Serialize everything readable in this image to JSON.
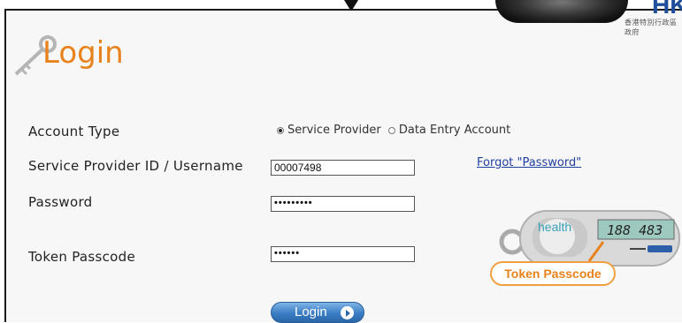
{
  "header": {
    "brand_text": "HKG",
    "brand_sub": "香港特別行政區政府"
  },
  "login": {
    "title": "Login",
    "account_type_label": "Account Type",
    "account_type_options": [
      "Service Provider",
      "Data Entry Account"
    ],
    "account_type_selected": "Service Provider",
    "username_label": "Service Provider ID / Username",
    "username_value": "00007498",
    "password_label": "Password",
    "password_value": "•••••••••",
    "token_label": "Token Passcode",
    "token_value": "••••••",
    "forgot_link": "Forgot \"Password\"",
    "login_button": "Login"
  },
  "token_device": {
    "brand": "health",
    "display": "188 483",
    "callout": "Token Passcode"
  },
  "colors": {
    "accent_orange": "#e8821c",
    "link_blue": "#1f3f9f",
    "button_blue": "#3a7dc4"
  }
}
